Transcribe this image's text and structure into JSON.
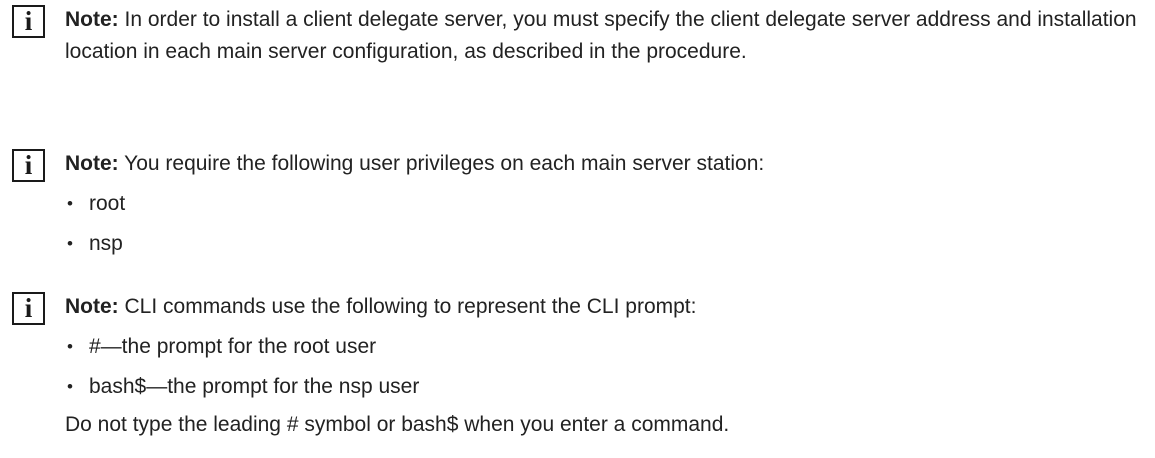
{
  "notes": [
    {
      "icon": "info-icon",
      "icon_glyph": "i",
      "label": "Note:",
      "text": " In order to install a client delegate server, you must specify the client delegate server address and installation location in each main server configuration, as described in the procedure."
    },
    {
      "icon": "info-icon",
      "icon_glyph": "i",
      "label": "Note:",
      "text": " You require the following user privileges on each main server station:",
      "items": [
        "root",
        "nsp"
      ]
    },
    {
      "icon": "info-icon",
      "icon_glyph": "i",
      "label": "Note:",
      "text": " CLI commands use the following to represent the CLI prompt:",
      "items": [
        "#—the prompt for the root user",
        "bash$—the prompt for the nsp user"
      ],
      "trailing": "Do not type the leading # symbol or bash$ when you enter a command."
    }
  ]
}
